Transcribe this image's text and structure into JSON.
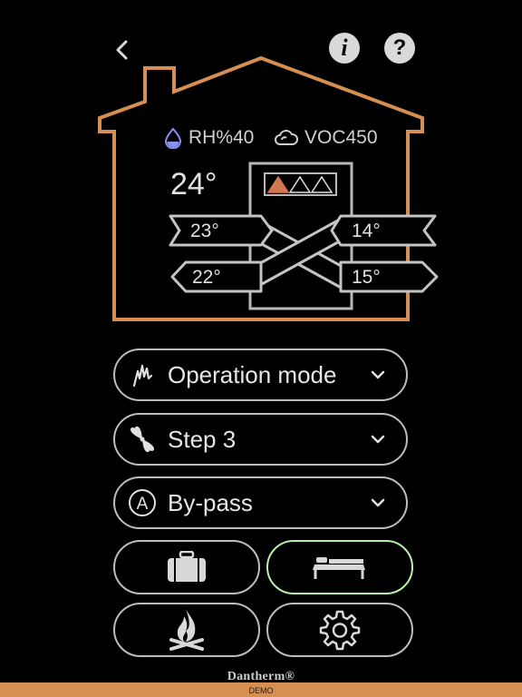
{
  "colors": {
    "house_outline": "#d58f52",
    "unit_outline": "#b8b8b8",
    "active_border": "#b9f0a8"
  },
  "header": {
    "back_icon": "chevron-left-icon",
    "info_icon": "info-icon",
    "help_icon": "help-icon",
    "info_glyph": "i",
    "help_glyph": "?"
  },
  "house": {
    "rh_label": "RH%40",
    "voc_label": "VOC450",
    "room_temp": "24°",
    "fan_level": "1 of 3",
    "temps": {
      "top_left": "23°",
      "top_right": "14°",
      "bottom_left": "22°",
      "bottom_right": "15°"
    }
  },
  "controls": {
    "operation_mode": "Operation mode",
    "fan_step": "Step 3",
    "bypass": "By-pass",
    "bypass_badge": "A"
  },
  "quick_buttons": [
    {
      "name": "away-button",
      "icon": "suitcase-icon",
      "active": false
    },
    {
      "name": "sleep-button",
      "icon": "bed-icon",
      "active": true
    },
    {
      "name": "fireplace-button",
      "icon": "campfire-icon",
      "active": false
    },
    {
      "name": "settings-button",
      "icon": "gear-icon",
      "active": false
    }
  ],
  "footer": {
    "brand": "Dantherm®",
    "mode": "DEMO"
  }
}
